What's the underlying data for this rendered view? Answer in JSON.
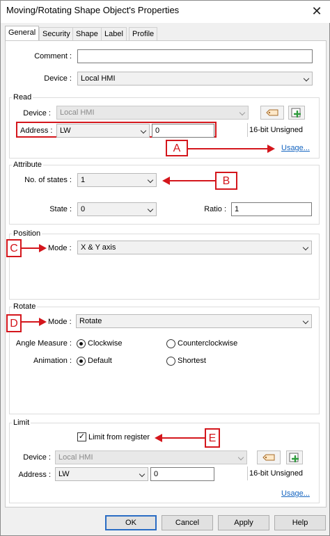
{
  "window": {
    "title": "Moving/Rotating Shape Object's Properties",
    "close": "✕"
  },
  "tabs": [
    "General",
    "Security",
    "Shape",
    "Label",
    "Profile"
  ],
  "general": {
    "comment_label": "Comment :",
    "comment_value": "",
    "device_label": "Device :",
    "device_value": "Local HMI"
  },
  "read": {
    "title": "Read",
    "device_label": "Device :",
    "device_value": "Local HMI",
    "address_label": "Address :",
    "address_type": "LW",
    "address_value": "0",
    "data_format": "16-bit Unsigned",
    "usage_link": "Usage..."
  },
  "attribute": {
    "title": "Attribute",
    "states_label": "No. of states :",
    "states_value": "1",
    "state_label": "State :",
    "state_value": "0",
    "ratio_label": "Ratio :",
    "ratio_value": "1"
  },
  "position": {
    "title": "Position",
    "mode_label": "Mode :",
    "mode_value": "X & Y axis"
  },
  "rotate": {
    "title": "Rotate",
    "mode_label": "Mode :",
    "mode_value": "Rotate",
    "angle_label": "Angle Measure :",
    "angle_options": [
      "Clockwise",
      "Counterclockwise"
    ],
    "angle_selected": 0,
    "animation_label": "Animation :",
    "animation_options": [
      "Default",
      "Shortest"
    ],
    "animation_selected": 0
  },
  "limit": {
    "title": "Limit",
    "checkbox_label": "Limit from register",
    "checked": true,
    "device_label": "Device :",
    "device_value": "Local HMI",
    "address_label": "Address :",
    "address_type": "LW",
    "address_value": "0",
    "data_format": "16-bit Unsigned",
    "usage_link": "Usage..."
  },
  "annotations": {
    "a": "A",
    "b": "B",
    "c": "C",
    "d": "D",
    "e": "E"
  },
  "buttons": {
    "ok": "OK",
    "cancel": "Cancel",
    "apply": "Apply",
    "help": "Help"
  },
  "colors": {
    "annotation": "#d4161c",
    "link": "#1565c0",
    "default_button_border": "#2a6cc4"
  },
  "icons": {
    "close": "close-icon",
    "address_book": "address-book-icon",
    "add": "add-icon",
    "dropdown": "chevron-down-icon"
  }
}
